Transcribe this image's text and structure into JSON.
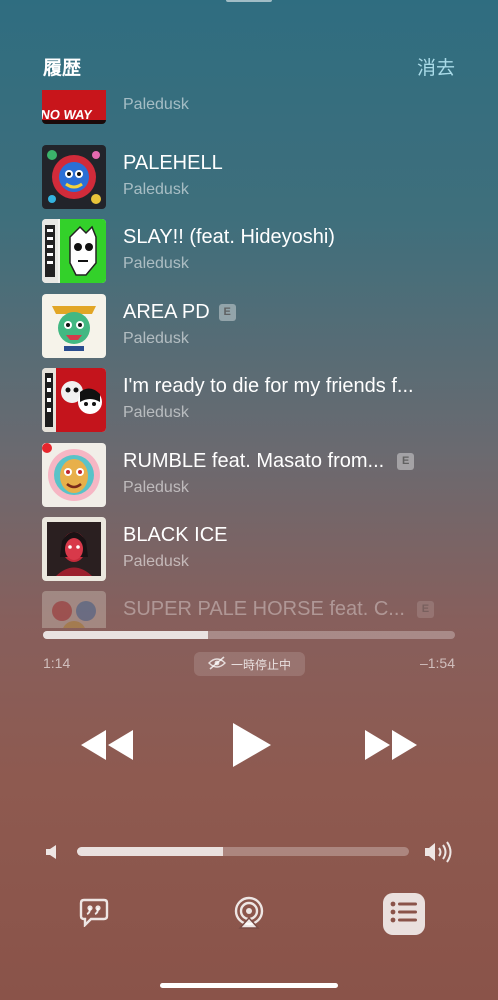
{
  "header": {
    "title": "履歴",
    "clear_label": "消去"
  },
  "tracks": [
    {
      "title": "",
      "artist": "Paledusk",
      "explicit": false,
      "art": "noway"
    },
    {
      "title": "PALEHELL",
      "artist": "Paledusk",
      "explicit": false,
      "art": "palehell"
    },
    {
      "title": "SLAY!! (feat. Hideyoshi)",
      "artist": "Paledusk",
      "explicit": false,
      "art": "slay"
    },
    {
      "title": "AREA PD",
      "artist": "Paledusk",
      "explicit": true,
      "art": "areapd"
    },
    {
      "title": "I'm ready to die for my friends f...",
      "artist": "Paledusk",
      "explicit": false,
      "art": "imready"
    },
    {
      "title": "RUMBLE feat. Masato from...",
      "artist": "Paledusk",
      "explicit": true,
      "art": "rumble"
    },
    {
      "title": "BLACK ICE",
      "artist": "Paledusk",
      "explicit": false,
      "art": "blackice"
    },
    {
      "title": "SUPER PALE HORSE feat. C...",
      "artist": "",
      "explicit": true,
      "art": "superpale"
    }
  ],
  "art_labels": {
    "noway": "NO WAY"
  },
  "explicit_label": "E",
  "playback": {
    "elapsed": "1:14",
    "remaining": "–1:54",
    "progress": 0.4,
    "status": "一時停止中",
    "volume": 0.44
  },
  "icons": {
    "rewind": "rewind-icon",
    "play": "play-icon",
    "forward": "fast-forward-icon",
    "lyrics": "lyrics-icon",
    "airplay": "airplay-icon",
    "queue": "queue-list-icon",
    "volume_low": "speaker-low-icon",
    "volume_high": "speaker-high-icon",
    "paused_status": "paused-status-icon"
  },
  "colors": {
    "accent": "#a9dbe8"
  }
}
